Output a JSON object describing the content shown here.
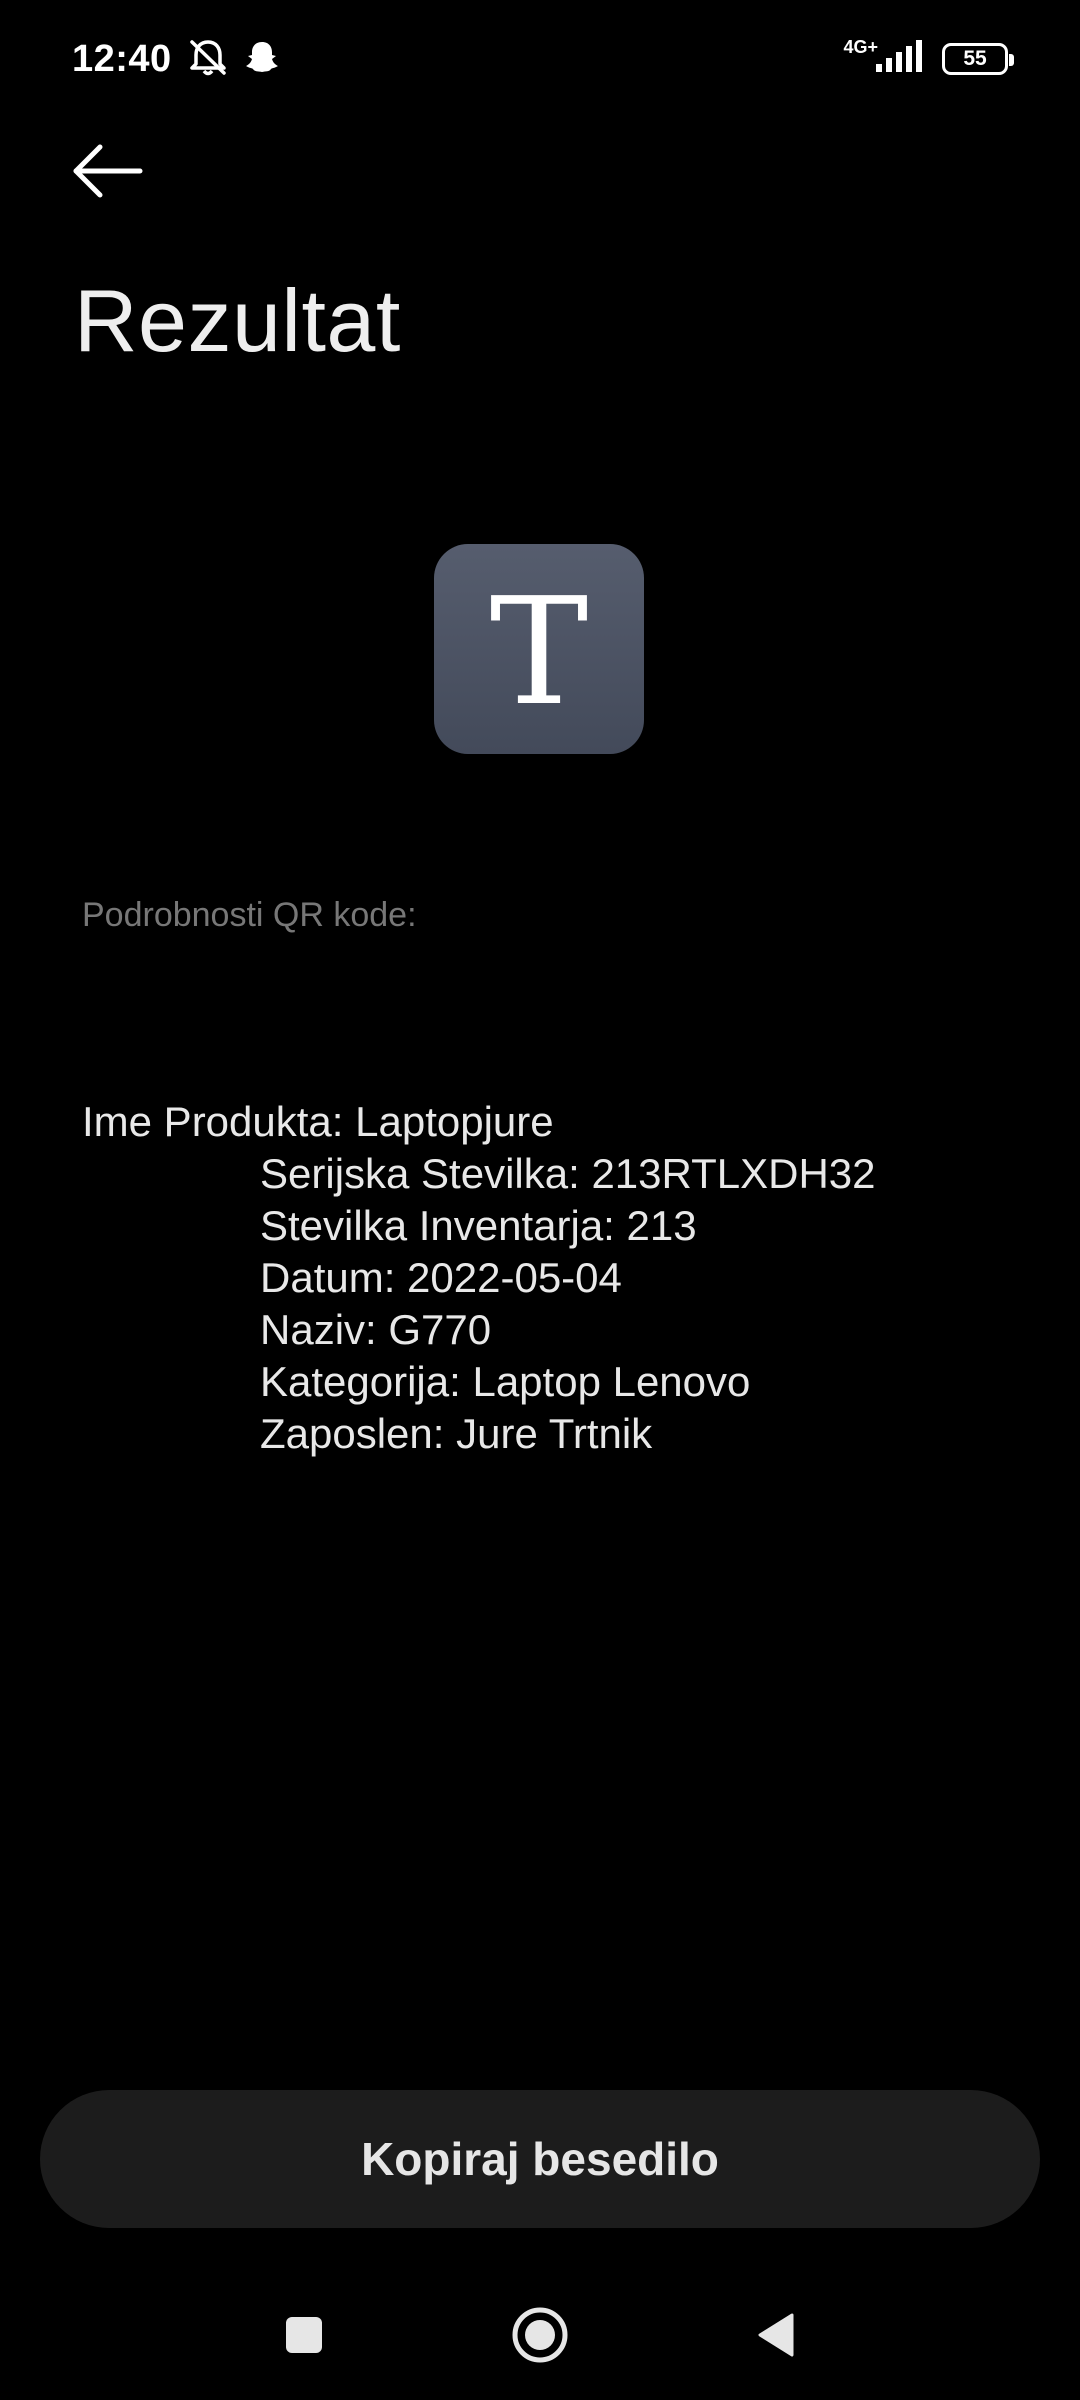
{
  "status_bar": {
    "time": "12:40",
    "network": "4G+",
    "battery": "55",
    "icons": [
      "notifications-muted-icon",
      "snapchat-ghost-icon",
      "signal-icon",
      "battery-icon"
    ]
  },
  "header": {
    "back_icon": "back-arrow-icon",
    "title": "Rezultat"
  },
  "result_icon": {
    "glyph": "T",
    "icon": "text-type-icon",
    "background": "#4d5464"
  },
  "details": {
    "label": "Podrobnosti QR kode:",
    "lines": [
      "Ime Produkta: Laptopjure",
      "Serijska Stevilka: 213RTLXDH32",
      "Stevilka Inventarja: 213",
      "Datum: 2022-05-04",
      "Naziv: G770",
      "Kategorija: Laptop Lenovo",
      "Zaposlen: Jure Trtnik"
    ]
  },
  "actions": {
    "copy_label": "Kopiraj besedilo"
  },
  "nav_bar": {
    "icons": [
      "recents-square-icon",
      "home-circle-icon",
      "back-triangle-icon"
    ]
  },
  "colors": {
    "background": "#000000",
    "button_bg": "#1c1c1c",
    "muted_text": "#777777"
  }
}
